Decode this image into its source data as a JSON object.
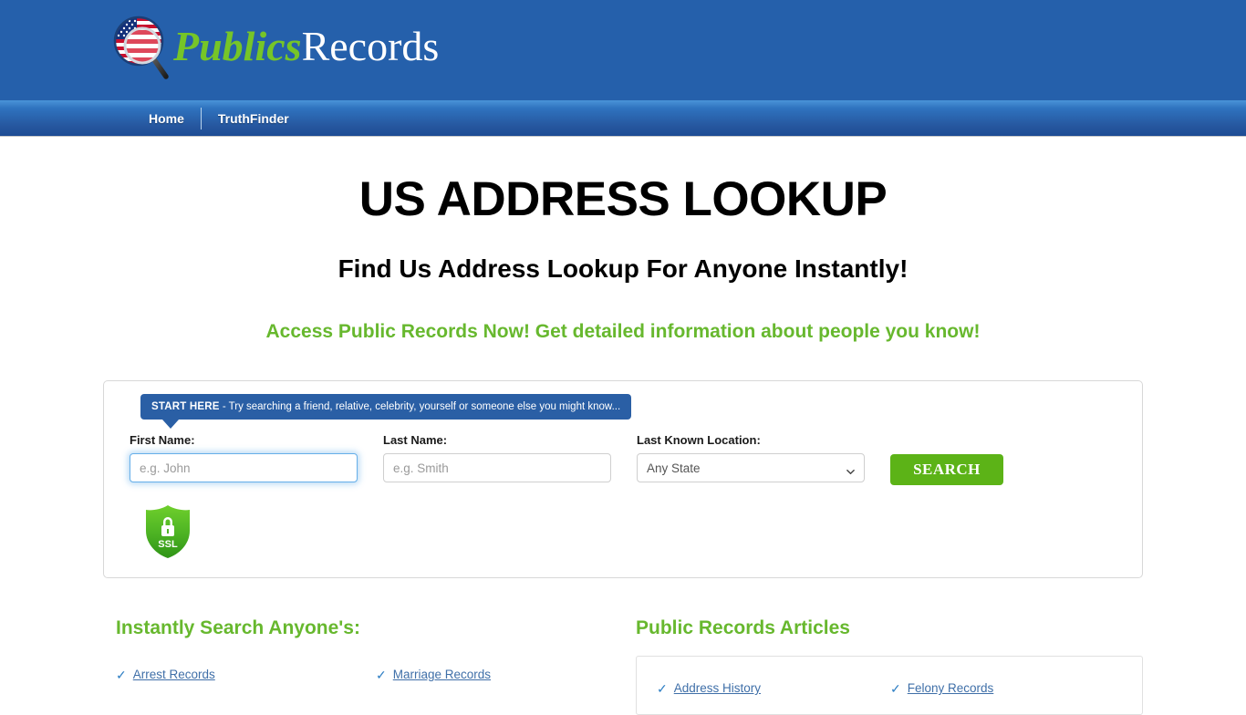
{
  "brand": {
    "logo_icon": "us-flag-magnifier-icon",
    "name_part_a": "Publics",
    "name_part_b": "Records",
    "header_bg": "#2560ab",
    "green": "#67b82e",
    "blue_link": "#3f6fa8"
  },
  "nav": {
    "items": [
      {
        "label": "Home"
      },
      {
        "label": "TruthFinder"
      }
    ]
  },
  "hero": {
    "title": "US ADDRESS LOOKUP",
    "subtitle": "Find Us Address Lookup For Anyone Instantly!",
    "tagline": "Access Public Records Now! Get detailed information about people you know!"
  },
  "search": {
    "banner_strong": "START HERE",
    "banner_rest": " - Try searching a friend, relative, celebrity, yourself or someone else you might know...",
    "first_name_label": "First Name:",
    "first_name_placeholder": "e.g. John",
    "first_name_value": "",
    "last_name_label": "Last Name:",
    "last_name_placeholder": "e.g. Smith",
    "last_name_value": "",
    "location_label": "Last Known Location:",
    "location_selected": "Any State",
    "location_options": [
      "Any State"
    ],
    "submit_label": "SEARCH",
    "ssl_badge_text": "SSL",
    "ssl_icon": "ssl-shield-lock-icon"
  },
  "instant_search": {
    "heading": "Instantly Search Anyone's:",
    "links": [
      {
        "label": "Arrest Records"
      },
      {
        "label": "Marriage Records"
      }
    ]
  },
  "articles": {
    "heading": "Public Records Articles",
    "links": [
      {
        "label": "Address History"
      },
      {
        "label": "Felony Records"
      }
    ]
  },
  "icons": {
    "check": "✓",
    "chevron_down": "chevron-down-icon"
  }
}
